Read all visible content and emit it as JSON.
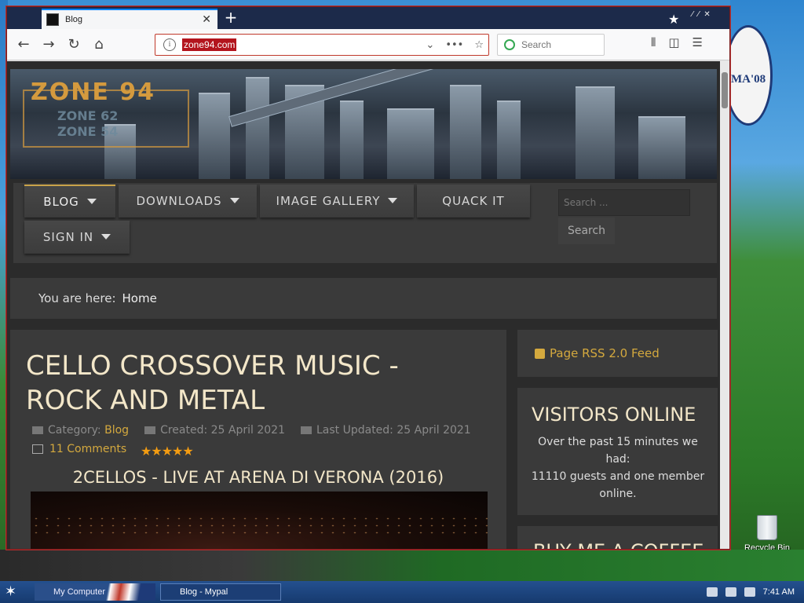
{
  "browser": {
    "tab_title": "Blog",
    "new_tab": "+",
    "url": "zone94.com",
    "search_placeholder": "Search"
  },
  "site": {
    "brand_main": "ZONE 94",
    "brand_sub1": "ZONE 62",
    "brand_sub2": "ZONE 54",
    "menu": {
      "blog": "BLOG",
      "downloads": "DOWNLOADS",
      "image_gallery": "IMAGE GALLERY",
      "quack_it": "QUACK IT",
      "sign_in": "SIGN IN",
      "search_placeholder": "Search ...",
      "search_button": "Search"
    },
    "breadcrumb": {
      "label": "You are here:",
      "home": "Home"
    },
    "article": {
      "title": "CELLO CROSSOVER MUSIC - ROCK AND METAL",
      "category_label": "Category:",
      "category": "Blog",
      "created": "Created: 25 April 2021",
      "updated": "Last Updated: 25 April 2021",
      "comments": "11 Comments",
      "rating": "★★★★★",
      "video_title": "2CELLOS - LIVE AT ARENA DI VERONA (2016)"
    },
    "sidebar": {
      "rss": "Page RSS 2.0 Feed",
      "visitors_title": "VISITORS ONLINE",
      "visitors_line1": "Over the past 15 minutes we had:",
      "visitors_line2": "11110 guests and one member online.",
      "coffee_title": "BUY ME A COFFEE"
    }
  },
  "desktop": {
    "recycle_bin": "Recycle Bin",
    "obama_text": "MA'08"
  },
  "taskbar": {
    "task1": "My Computer",
    "task2": "Blog - Mypal",
    "time": "7:41 AM"
  },
  "colors": {
    "accent_gold": "#d4a93e",
    "url_highlight": "#b3141d",
    "page_bg": "#2b2b2b"
  }
}
